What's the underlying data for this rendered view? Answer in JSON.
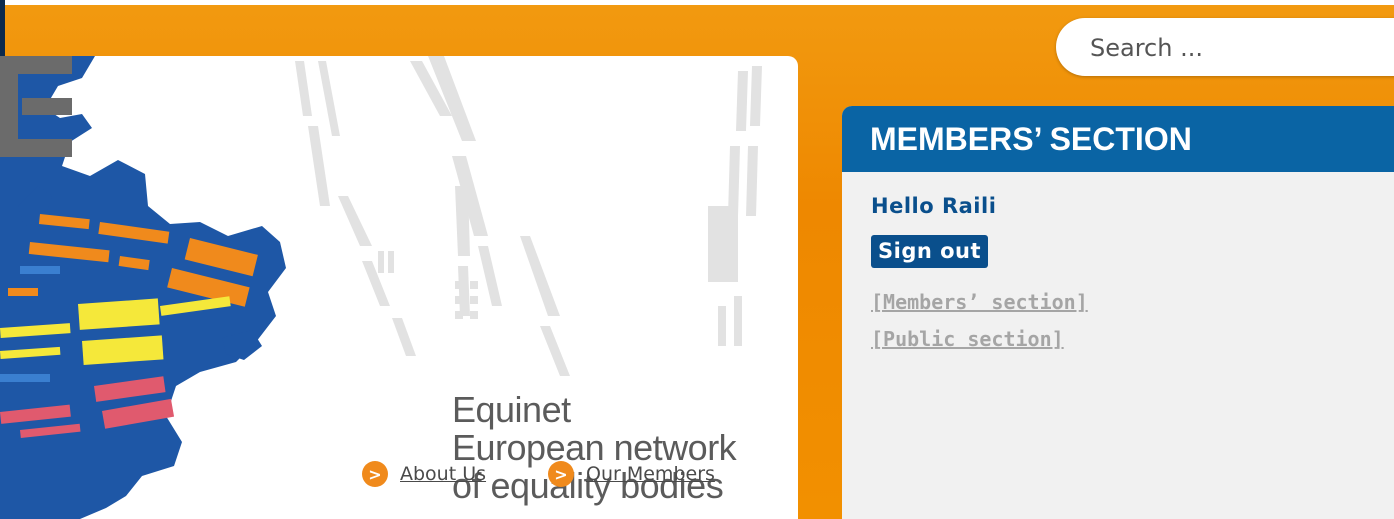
{
  "search": {
    "placeholder": "Search ..."
  },
  "banner": {
    "logo": {
      "line1": "Equinet",
      "line2": "European network",
      "line3": "of equality bodies"
    },
    "links": [
      {
        "label": "About Us",
        "icon": "arrow-right-icon"
      },
      {
        "label": "Our Members",
        "icon": "arrow-right-icon"
      }
    ]
  },
  "members": {
    "title": "MEMBERS’ SECTION",
    "greeting": "Hello Raili",
    "sign_out": "Sign out",
    "links": [
      {
        "label": "[Members’ section]"
      },
      {
        "label": "[Public section]"
      }
    ]
  },
  "colors": {
    "page_background": "#f08a00",
    "header_blue": "#0a64a4",
    "text_blue": "#0a4f8c",
    "link_gray": "#a5a5a5",
    "logo_gray": "#5b5b5b",
    "accent_orange": "#f08a1c"
  }
}
